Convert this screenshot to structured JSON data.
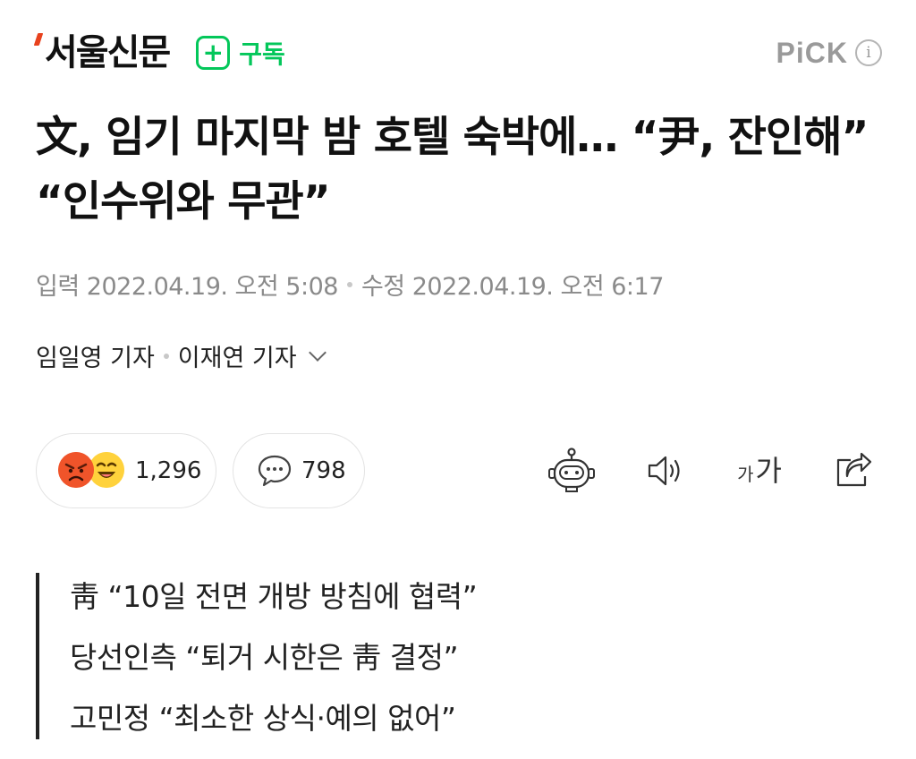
{
  "header": {
    "logo": "서울신문",
    "subscribe_label": "구독",
    "pick_label": "PiCK",
    "info_glyph": "i"
  },
  "article": {
    "title": "文, 임기 마지막 밤 호텔 숙박에… “尹, 잔인해” “인수위와 무관”",
    "published_label": "입력",
    "published": "2022.04.19. 오전 5:08",
    "modified_label": "수정",
    "modified": "2022.04.19. 오전 6:17",
    "reporters": [
      "임일영 기자",
      "이재연 기자"
    ]
  },
  "engagement": {
    "reactions_count": "1,296",
    "comments_count": "798"
  },
  "toolbar": {
    "font_small": "가",
    "font_big": "가"
  },
  "subheads": [
    "靑 “10일 전면 개방 방침에 협력”",
    "당선인측 “퇴거 시한은 靑 결정”",
    "고민정 “최소한 상식·예의 없어”"
  ],
  "colors": {
    "brand_green": "#03c75a",
    "logo_accent": "#e8421e",
    "angry_face": "#f0542a",
    "laugh_face": "#ffd23c"
  },
  "icons": [
    "plus-icon",
    "info-icon",
    "angry-face-icon",
    "laughing-face-icon",
    "comment-icon",
    "chatbot-icon",
    "speaker-icon",
    "font-size-icon",
    "share-icon",
    "chevron-down-icon"
  ]
}
